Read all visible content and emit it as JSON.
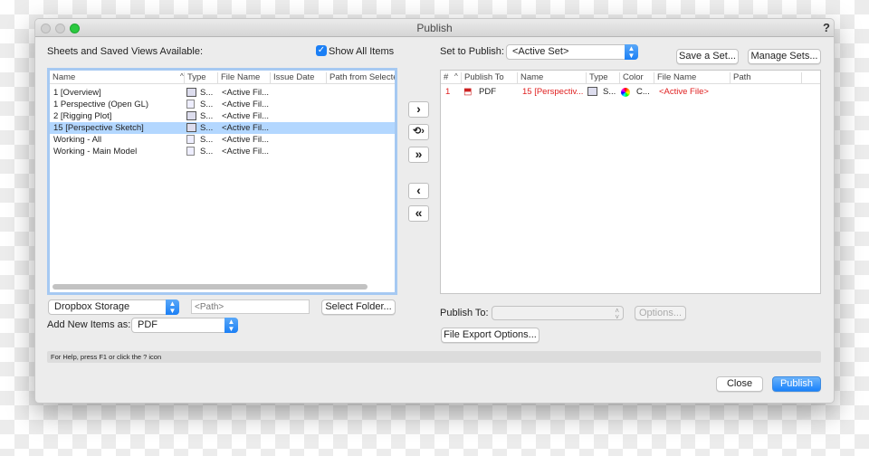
{
  "window": {
    "title": "Publish",
    "help": "?"
  },
  "left": {
    "heading": "Sheets and Saved Views Available:",
    "show_all": {
      "label": "Show All Items",
      "checked": true
    },
    "columns": [
      "Name",
      "Type",
      "File Name",
      "Issue Date",
      "Path from Selected"
    ],
    "rows": [
      {
        "name": "1 [Overview]",
        "type": "S...",
        "file": "<Active Fil...",
        "icon": "sheet-layer-icon"
      },
      {
        "name": "1 Perspective (Open GL)",
        "type": "S...",
        "file": "<Active Fil...",
        "icon": "saved-view-icon"
      },
      {
        "name": "2 [Rigging Plot]",
        "type": "S...",
        "file": "<Active Fil...",
        "icon": "sheet-layer-icon"
      },
      {
        "name": "15 [Perspective Sketch]",
        "type": "S...",
        "file": "<Active Fil...",
        "icon": "sheet-layer-icon",
        "selected": true
      },
      {
        "name": "Working - All",
        "type": "S...",
        "file": "<Active Fil...",
        "icon": "saved-view-icon"
      },
      {
        "name": "Working - Main Model",
        "type": "S...",
        "file": "<Active Fil...",
        "icon": "saved-view-icon"
      }
    ],
    "storage": "Dropbox Storage",
    "path_placeholder": "<Path>",
    "select_folder": "Select Folder...",
    "add_new_label": "Add New Items as:",
    "add_new_value": "PDF"
  },
  "transfer": {
    "add": "›",
    "add_special": "⟲›",
    "add_all": "»",
    "remove": "‹",
    "remove_all": "«"
  },
  "right": {
    "set_label": "Set to Publish:",
    "set_value": "<Active Set>",
    "save_set": "Save a Set...",
    "manage_sets": "Manage Sets...",
    "columns": [
      "#",
      "Publish To",
      "Name",
      "Type",
      "Color",
      "File Name",
      "Path"
    ],
    "rows": [
      {
        "num": "1",
        "publish_to": "PDF",
        "name": "15 [Perspectiv...",
        "type": "S...",
        "color": "C...",
        "file": "<Active File>"
      }
    ],
    "publish_to_label": "Publish To:",
    "options": "Options...",
    "file_export": "File Export Options..."
  },
  "status": "For Help, press F1 or click the ? icon",
  "footer": {
    "close": "Close",
    "publish": "Publish"
  },
  "colors": {
    "accent": "#1a82fb",
    "selection": "#b3d7ff",
    "publish_row": "#e02020"
  }
}
